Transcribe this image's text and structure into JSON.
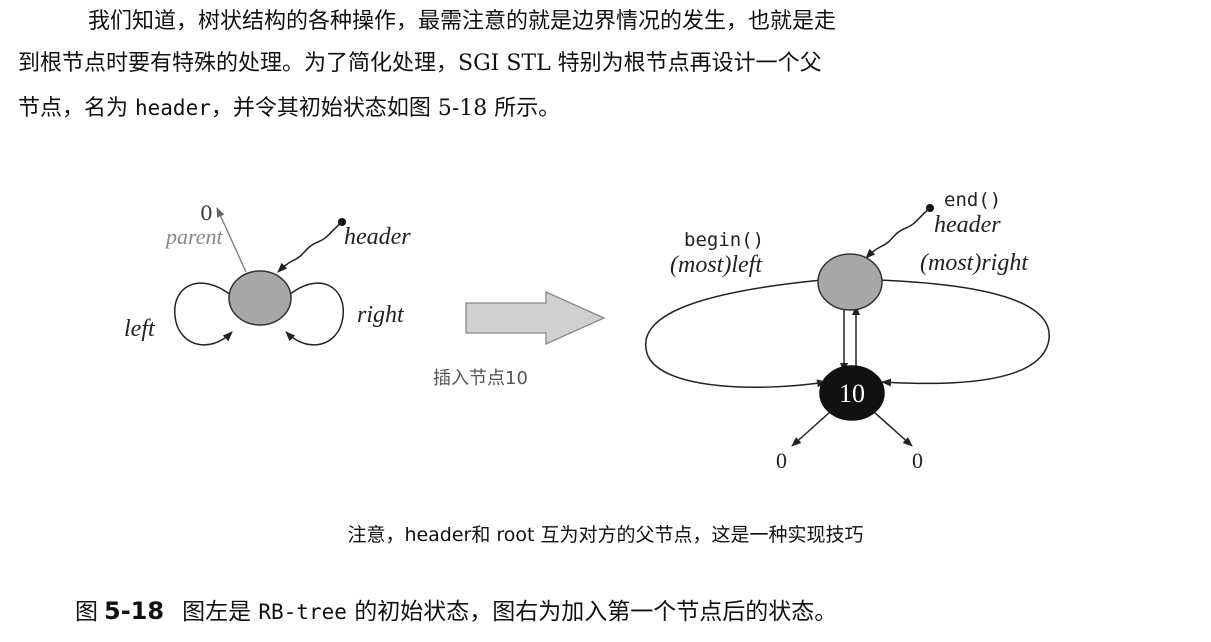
{
  "paragraph": {
    "line1": "我们知道，树状结构的各种操作，最需注意的就是边界情况的发生，也就是走",
    "line2": "到根节点时要有特殊的处理。为了简化处理，SGI STL 特别为根节点再设计一个父",
    "line3_pre": "节点，名为 ",
    "line3_code": "header",
    "line3_post": "，并令其初始状态如图 5-18 所示。"
  },
  "figure": {
    "left": {
      "zero": "0",
      "parent": "parent",
      "header": "header",
      "left": "left",
      "right": "right"
    },
    "arrow_label": "插入节点10",
    "right": {
      "end": "end()",
      "header": "header",
      "begin": "begin()",
      "most_left": "(most)left",
      "most_right": "(most)right",
      "node_value": "10",
      "zero_left": "0",
      "zero_right": "0"
    },
    "colors": {
      "header_node": "#a8a8a8",
      "root_node": "#111111",
      "insert_arrow": "#d0d0d0"
    }
  },
  "note": "注意，header和 root 互为对方的父节点，这是一种实现技巧",
  "caption": {
    "prefix": "图",
    "number": "5-18",
    "text_pre": "图左是 ",
    "code": "RB-tree",
    "text_post": " 的初始状态，图右为加入第一个节点后的状态。"
  }
}
